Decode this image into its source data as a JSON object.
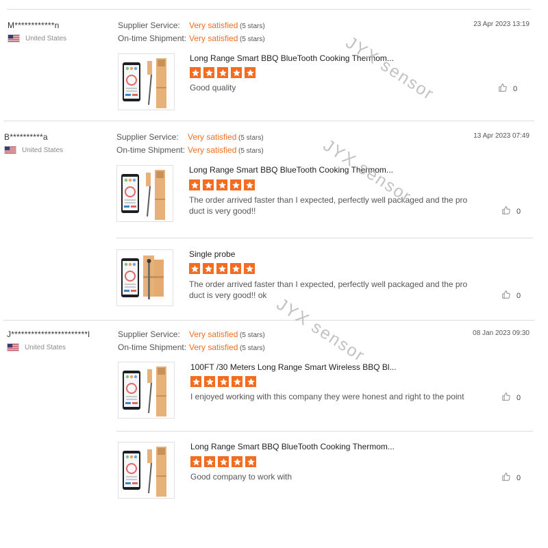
{
  "watermark": "JYX sensor",
  "colors": {
    "accent": "#f36c21",
    "divider": "#dcdcdc",
    "wood": "#e6b27a"
  },
  "reviews": [
    {
      "buyer": "M************n",
      "country": "United States",
      "supplier_service_label": "Supplier Service:",
      "supplier_service_value": "Very satisfied",
      "supplier_service_stars": "(5 stars)",
      "shipment_label": "On-time Shipment:",
      "shipment_value": "Very satisfied",
      "shipment_stars": "(5 stars)",
      "date": "23 Apr 2023 13:19",
      "items": [
        {
          "title": "Long Range Smart BBQ BlueTooth Cooking Thermom...",
          "rating": 5,
          "text": "Good quality",
          "likes": "0",
          "thumb_icon": "thermometer-product-icon"
        }
      ]
    },
    {
      "buyer": "B**********a",
      "country": "United States",
      "supplier_service_label": "Supplier Service:",
      "supplier_service_value": "Very satisfied",
      "supplier_service_stars": "(5 stars)",
      "shipment_label": "On-time Shipment:",
      "shipment_value": "Very satisfied",
      "shipment_stars": "(5 stars)",
      "date": "13 Apr 2023 07:49",
      "items": [
        {
          "title": "Long Range Smart BBQ BlueTooth Cooking Thermom...",
          "rating": 5,
          "text": "The order arrived faster than I expected, perfectly well packaged and the product is very good!!",
          "likes": "0",
          "thumb_icon": "thermometer-product-icon"
        },
        {
          "title": "Single probe",
          "rating": 5,
          "text": "The order arrived faster than I expected, perfectly well packaged and the product is very good!! ok",
          "likes": "0",
          "thumb_icon": "single-probe-product-icon"
        }
      ]
    },
    {
      "buyer": "J***********************l",
      "country": "United States",
      "supplier_service_label": "Supplier Service:",
      "supplier_service_value": "Very satisfied",
      "supplier_service_stars": "(5 stars)",
      "shipment_label": "On-time Shipment:",
      "shipment_value": "Very satisfied",
      "shipment_stars": "(5 stars)",
      "date": "08 Jan 2023 09:30",
      "items": [
        {
          "title": "100FT /30 Meters Long Range Smart Wireless BBQ Bl...",
          "rating": 5,
          "text": "I enjoyed working with this company they were honest and right to the point",
          "likes": "0",
          "thumb_icon": "thermometer-product-icon"
        },
        {
          "title": "Long Range Smart BBQ BlueTooth Cooking Thermom...",
          "rating": 5,
          "text": "Good company to work with",
          "likes": "0",
          "thumb_icon": "thermometer-product-icon"
        }
      ]
    }
  ]
}
